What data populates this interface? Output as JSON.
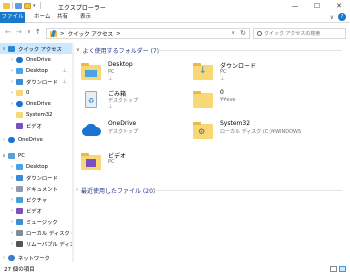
{
  "window": {
    "title": "エクスプローラー",
    "minimize": "—",
    "maximize": "☐",
    "close": "✕"
  },
  "ribbon": {
    "tabs": [
      "ファイル",
      "ホーム",
      "共有",
      "表示"
    ],
    "help": "?"
  },
  "nav": {
    "back": "←",
    "forward": "→",
    "up_recent": "∨",
    "up": "↑",
    "address_path": "クイック アクセス",
    "address_sep": ">",
    "search_placeholder": "クイック アクセスの検索"
  },
  "sidebar": {
    "items": [
      {
        "label": "クイック アクセス",
        "icon": "star-icon",
        "arrow": "∨",
        "selected": true
      },
      {
        "label": "OneDrive",
        "icon": "cloud-icon",
        "arrow": "›"
      },
      {
        "label": "Desktop",
        "icon": "desktop-icon",
        "arrow": "›",
        "pinned": true
      },
      {
        "label": "ダウンロード",
        "icon": "download-icon",
        "arrow": "›",
        "pinned": true
      },
      {
        "label": "0",
        "icon": "folder-icon",
        "arrow": "›"
      },
      {
        "label": "OneDrive",
        "icon": "cloud-icon",
        "arrow": "›"
      },
      {
        "label": "System32",
        "icon": "folder-icon",
        "arrow": ""
      },
      {
        "label": "ビデオ",
        "icon": "video-icon",
        "arrow": ""
      },
      {
        "label": "OneDrive",
        "icon": "cloud-icon",
        "arrow": "›"
      },
      {
        "label": "PC",
        "icon": "pc-icon",
        "arrow": "∨"
      },
      {
        "label": "Desktop",
        "icon": "desktop-icon",
        "arrow": "›"
      },
      {
        "label": "ダウンロード",
        "icon": "download-icon",
        "arrow": "›"
      },
      {
        "label": "ドキュメント",
        "icon": "document-icon",
        "arrow": "›"
      },
      {
        "label": "ピクチャ",
        "icon": "picture-icon",
        "arrow": "›"
      },
      {
        "label": "ビデオ",
        "icon": "video-icon",
        "arrow": "›"
      },
      {
        "label": "ミュージック",
        "icon": "music-icon",
        "arrow": "›"
      },
      {
        "label": "ローカル ディスク (C:)",
        "icon": "drive-icon",
        "arrow": "›"
      },
      {
        "label": "リムーバブル ディスク (E:)",
        "icon": "removable-drive-icon",
        "arrow": "›"
      },
      {
        "label": "ネットワーク",
        "icon": "network-icon",
        "arrow": "›"
      }
    ],
    "pin_glyph": "📌"
  },
  "main": {
    "frequent_header": "よく使用するフォルダー (7)",
    "recent_header": "最近使用したファイル (20)",
    "header_arrow_open": "∨",
    "header_arrow_closed": "›",
    "folders": [
      {
        "name": "Desktop",
        "sub": "PC",
        "pinned": true,
        "icon": "desktop-folder-icon"
      },
      {
        "name": "ダウンロード",
        "sub": "PC",
        "pinned": true,
        "icon": "download-folder-icon"
      },
      {
        "name": "ごみ箱",
        "sub": "デスクトップ",
        "pinned": true,
        "icon": "recycle-bin-icon"
      },
      {
        "name": "0",
        "sub": "¥¥eve",
        "pinned": false,
        "icon": "folder-icon"
      },
      {
        "name": "OneDrive",
        "sub": "デスクトップ",
        "pinned": false,
        "icon": "onedrive-icon"
      },
      {
        "name": "System32",
        "sub": "ローカル ディスク (C:)¥WINDOWS",
        "pinned": false,
        "icon": "system-folder-icon"
      },
      {
        "name": "ビデオ",
        "sub": "PC",
        "pinned": false,
        "icon": "video-folder-icon"
      }
    ]
  },
  "status": {
    "count": "27 個の項目"
  },
  "colors": {
    "accent": "#1979ca",
    "selection": "#cce8ff",
    "folder": "#f8d775",
    "header_text": "#1e3287"
  }
}
